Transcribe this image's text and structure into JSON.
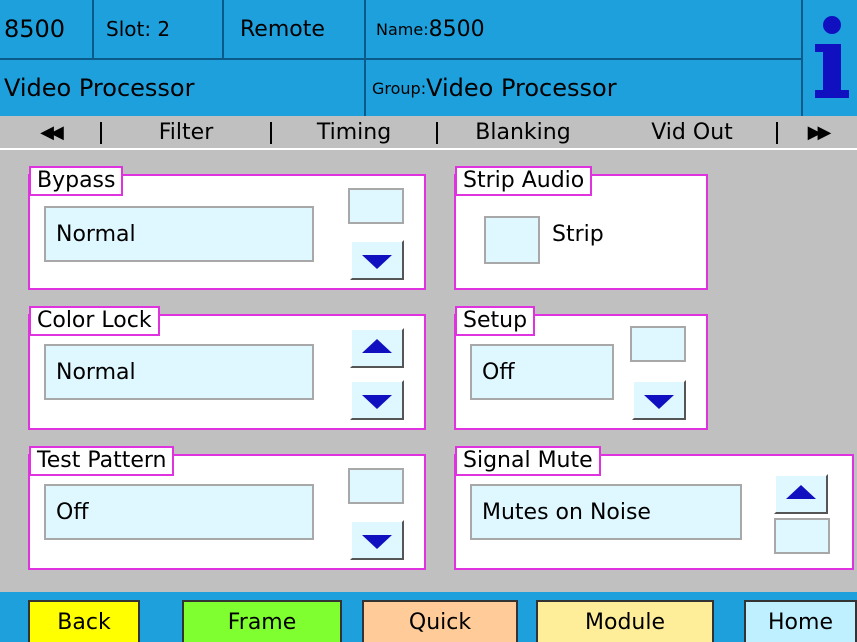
{
  "header": {
    "model": "8500",
    "slot": "Slot: 2",
    "mode": "Remote",
    "name_label": "Name:",
    "name_value": "8500",
    "product": "Video Processor",
    "group_label": "Group:",
    "group_value": "Video Processor",
    "info_icon": "info-icon",
    "colors": {
      "header_bg": "#1ea0dc",
      "info": "#1010c0"
    }
  },
  "tabs": {
    "prev": "◀◀",
    "next": "▶▶",
    "items": [
      "Filter",
      "Timing",
      "Blanking",
      "Vid Out"
    ],
    "selected": "Vid Out"
  },
  "groups": {
    "bypass": {
      "title": "Bypass",
      "value": "Normal"
    },
    "strip_audio": {
      "title": "Strip Audio",
      "checkbox_label": "Strip",
      "checked": false
    },
    "color_lock": {
      "title": "Color Lock",
      "value": "Normal"
    },
    "setup": {
      "title": "Setup",
      "value": "Off"
    },
    "test_pattern": {
      "title": "Test Pattern",
      "value": "Off"
    },
    "signal_mute": {
      "title": "Signal Mute",
      "value": "Mutes on Noise"
    }
  },
  "footer": {
    "back": "Back",
    "frame": "Frame",
    "quick": "Quick",
    "module": "Module",
    "home": "Home",
    "colors": {
      "back": "#ffff00",
      "frame": "#80ff30",
      "quick": "#ffcc99",
      "module": "#ffee99",
      "home": "#bff0ff",
      "bar": "#1ea0dc",
      "group_border": "#e033e0",
      "field_bg": "#dff8ff"
    }
  }
}
